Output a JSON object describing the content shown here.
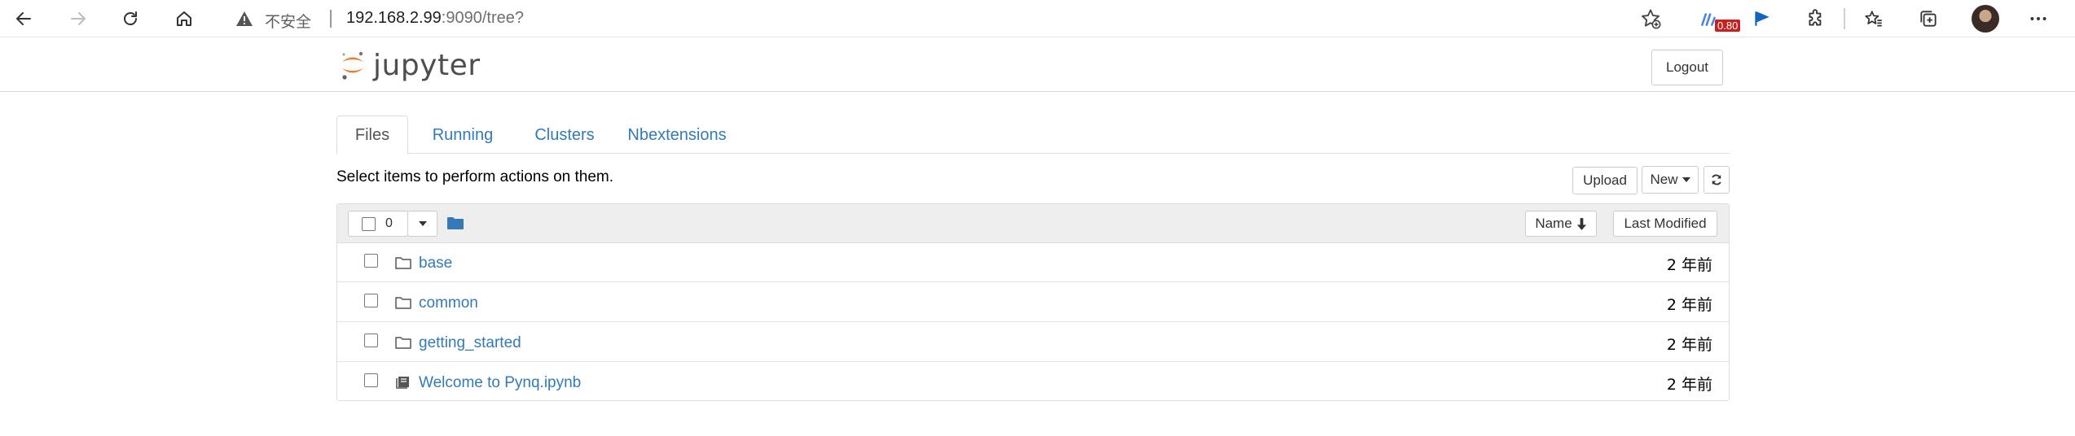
{
  "browser": {
    "insecure_label": "不安全",
    "url_host": "192.168.2.99",
    "url_rest": ":9090/tree?",
    "extension_badge": "0.80"
  },
  "jupyter": {
    "logo_text": "jupyter",
    "logout_label": "Logout"
  },
  "tabs": [
    {
      "label": "Files"
    },
    {
      "label": "Running"
    },
    {
      "label": "Clusters"
    },
    {
      "label": "Nbextensions"
    }
  ],
  "toolbar": {
    "hint": "Select items to perform actions on them.",
    "upload_label": "Upload",
    "new_label": "New"
  },
  "list_header": {
    "selected_count": "0",
    "sort_name_label": "Name",
    "last_modified_label": "Last Modified"
  },
  "files": [
    {
      "name": "base",
      "type": "folder",
      "modified": "2 年前"
    },
    {
      "name": "common",
      "type": "folder",
      "modified": "2 年前"
    },
    {
      "name": "getting_started",
      "type": "folder",
      "modified": "2 年前"
    },
    {
      "name": "Welcome to Pynq.ipynb",
      "type": "notebook",
      "modified": "2 年前"
    }
  ],
  "colors": {
    "link": "#337ab7",
    "jupyter_orange": "#f37726",
    "badge_red": "#c5221f"
  }
}
